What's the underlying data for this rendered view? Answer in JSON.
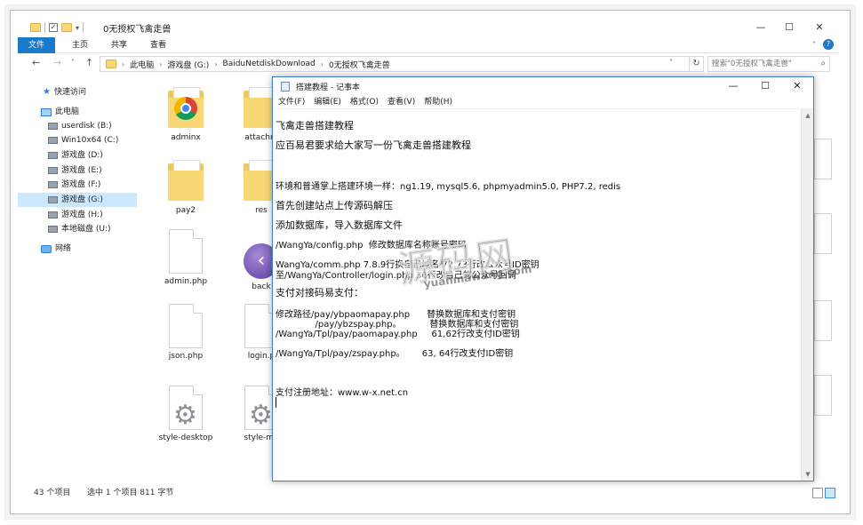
{
  "explorer": {
    "window_title": "0无授权飞禽走兽",
    "ribbon_tabs": [
      "文件",
      "主页",
      "共享",
      "查看"
    ],
    "breadcrumb": [
      "此电脑",
      "游戏盘 (G:)",
      "BaiduNetdiskDownload",
      "0无授权飞禽走兽"
    ],
    "search_placeholder": "搜索\"0无授权飞禽走兽\"",
    "nav_items": [
      {
        "label": "快速访问",
        "icon": "star-icon"
      },
      {
        "label": "此电脑",
        "icon": "computer-icon"
      },
      {
        "label": "userdisk (B:)",
        "icon": "drive-icon"
      },
      {
        "label": "Win10x64 (C:)",
        "icon": "drive-icon"
      },
      {
        "label": "游戏盘 (D:)",
        "icon": "drive-icon"
      },
      {
        "label": "游戏盘 (E:)",
        "icon": "drive-icon"
      },
      {
        "label": "游戏盘 (F:)",
        "icon": "drive-icon"
      },
      {
        "label": "游戏盘 (G:)",
        "icon": "drive-icon",
        "selected": true
      },
      {
        "label": "游戏盘 (H:)",
        "icon": "drive-icon"
      },
      {
        "label": "本地磁盘 (U:)",
        "icon": "drive-icon"
      },
      {
        "label": "网络",
        "icon": "network-icon"
      }
    ],
    "files": [
      {
        "label": "adminx",
        "type": "chrome"
      },
      {
        "label": "attachm",
        "type": "folder"
      },
      {
        "label": "pay2",
        "type": "folder"
      },
      {
        "label": "res",
        "type": "folder"
      },
      {
        "label": "admin.php",
        "type": "doc"
      },
      {
        "label": "back",
        "type": "purple"
      },
      {
        "label": "json.php",
        "type": "doc"
      },
      {
        "label": "login.p",
        "type": "doc"
      },
      {
        "label": "style-desktop",
        "type": "gear"
      },
      {
        "label": "style-mo",
        "type": "gear"
      }
    ],
    "status": {
      "count": "43 个项目",
      "selection": "选中 1 个项目  811 字节"
    }
  },
  "notepad": {
    "title": "搭建教程 - 记事本",
    "menu": [
      "文件(F)",
      "编辑(E)",
      "格式(O)",
      "查看(V)",
      "帮助(H)"
    ],
    "lines": [
      "飞禽走兽搭建教程",
      "应百易君要求给大家写一份飞禽走兽搭建教程",
      "环境和普通掌上搭建环境一样：ng1.19, mysql5.6, phpmyadmin5.0, PHP7.2, redis",
      "首先创建站点上传源码解压",
      "添加数据库，导入数据库文件",
      "/WangYa/config.php  修改数据库名称账号密码",
      "WangYa/comm.php 7.8.9行换自己域名 72.73行改公众号ID密钥",
      "至/WangYa/Controller/login.php 36行改自己的公众号回调",
      "支付对接码易支付：",
      "修改路径/pay/ybpaomapay.php      替换数据库和支付密钥",
      "              /pay/ybzspay.php。          替换数据库和支付密钥",
      "/WangYa/Tpl/pay/paomapay.php     61,62行改支付ID密钥",
      "/WangYa/Tpl/pay/zspay.php。      63, 64行改支付ID密钥",
      "支付注册地址：www.w-x.net.cn"
    ]
  },
  "watermark": {
    "main": "源码网",
    "sub": "yuanmawang.com"
  }
}
